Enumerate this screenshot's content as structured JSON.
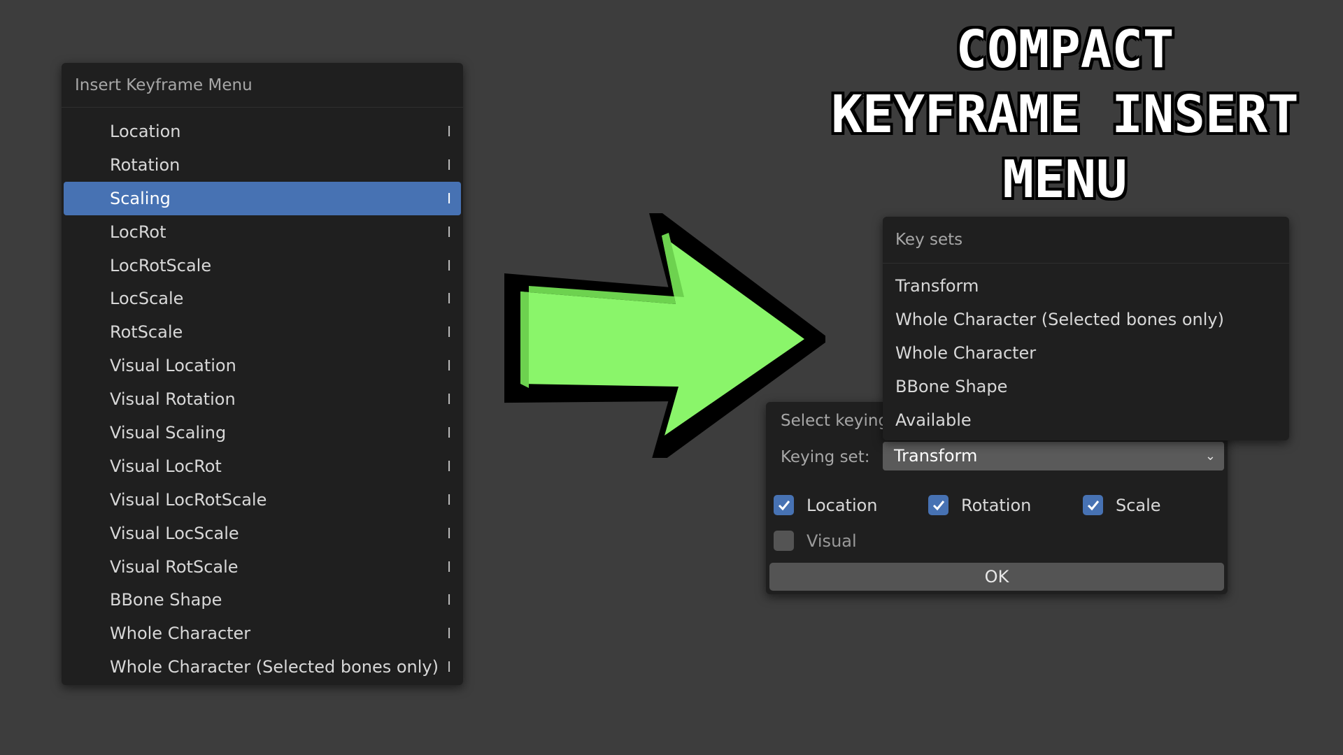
{
  "headline": {
    "line1": "COMPACT",
    "line2": "KEYFRAME INSERT",
    "line3": "MENU"
  },
  "insert_menu": {
    "title": "Insert Keyframe Menu",
    "items": [
      {
        "label": "Location",
        "shortcut": "I",
        "active": false
      },
      {
        "label": "Rotation",
        "shortcut": "I",
        "active": false
      },
      {
        "label": "Scaling",
        "shortcut": "I",
        "active": true
      },
      {
        "label": "LocRot",
        "shortcut": "I",
        "active": false
      },
      {
        "label": "LocRotScale",
        "shortcut": "I",
        "active": false
      },
      {
        "label": "LocScale",
        "shortcut": "I",
        "active": false
      },
      {
        "label": "RotScale",
        "shortcut": "I",
        "active": false
      },
      {
        "label": "Visual Location",
        "shortcut": "I",
        "active": false
      },
      {
        "label": "Visual Rotation",
        "shortcut": "I",
        "active": false
      },
      {
        "label": "Visual Scaling",
        "shortcut": "I",
        "active": false
      },
      {
        "label": "Visual LocRot",
        "shortcut": "I",
        "active": false
      },
      {
        "label": "Visual LocRotScale",
        "shortcut": "I",
        "active": false
      },
      {
        "label": "Visual LocScale",
        "shortcut": "I",
        "active": false
      },
      {
        "label": "Visual RotScale",
        "shortcut": "I",
        "active": false
      },
      {
        "label": "BBone Shape",
        "shortcut": "I",
        "active": false
      },
      {
        "label": "Whole Character",
        "shortcut": "I",
        "active": false
      },
      {
        "label": "Whole Character (Selected bones only)",
        "shortcut": "I",
        "active": false
      }
    ]
  },
  "arrow": {
    "icon": "right-arrow-icon",
    "color": "#8af56a"
  },
  "dialog": {
    "title": "Select keying",
    "keying_set_label": "Keying set:",
    "keying_set_value": "Transform",
    "checkboxes": {
      "location": {
        "label": "Location",
        "checked": true
      },
      "rotation": {
        "label": "Rotation",
        "checked": true
      },
      "scale": {
        "label": "Scale",
        "checked": true
      },
      "visual": {
        "label": "Visual",
        "checked": false
      }
    },
    "ok_label": "OK"
  },
  "key_sets": {
    "title": "Key sets",
    "items": [
      "Transform",
      "Whole Character (Selected bones only)",
      "Whole Character",
      "BBone Shape",
      "Available"
    ]
  },
  "colors": {
    "background": "#3d3d3d",
    "menu_bg": "#1f1f1f",
    "accent": "#4772b3",
    "arrow": "#8af56a"
  }
}
